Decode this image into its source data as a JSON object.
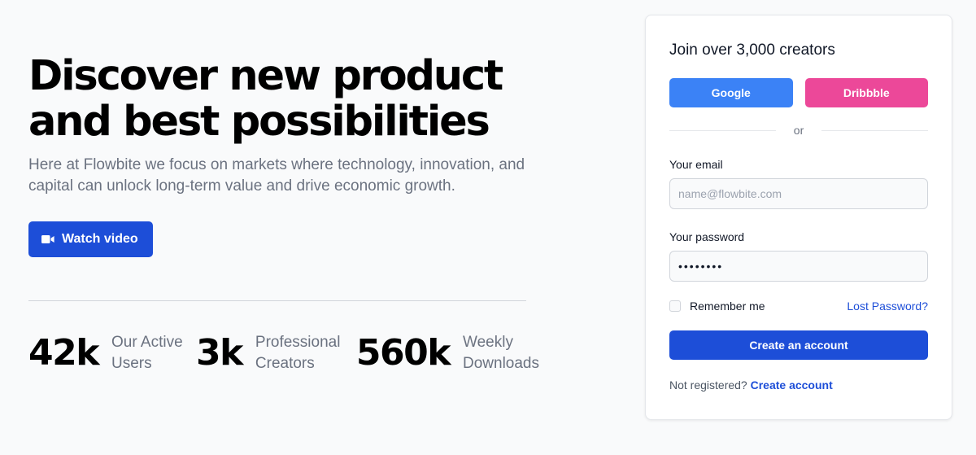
{
  "hero": {
    "title_line1": "Discover new product",
    "title_line2": "and best possibilities",
    "lead": "Here at Flowbite we focus on markets where technology, innovation, and capital can unlock long-term value and drive economic growth.",
    "watch_button": "Watch video",
    "watch_icon": "video-camera-icon"
  },
  "stats": [
    {
      "value": "42k",
      "label": "Our Active Users"
    },
    {
      "value": "3k",
      "label": "Professional Creators"
    },
    {
      "value": "560k",
      "label": "Weekly Downloads"
    }
  ],
  "signup": {
    "heading": "Join over 3,000 creators",
    "google_button": "Google",
    "dribbble_button": "Dribbble",
    "or_label": "or",
    "email_label": "Your email",
    "email_placeholder": "name@flowbite.com",
    "password_label": "Your password",
    "password_value": "••••••••",
    "remember_label": "Remember me",
    "lost_password_link": "Lost Password?",
    "create_button": "Create an account",
    "not_registered_text": "Not registered?",
    "create_account_link": "Create account"
  },
  "colors": {
    "primary": "#1d4ed8",
    "google": "#3b82f6",
    "dribbble": "#ec4899",
    "background": "#f9fafb"
  }
}
